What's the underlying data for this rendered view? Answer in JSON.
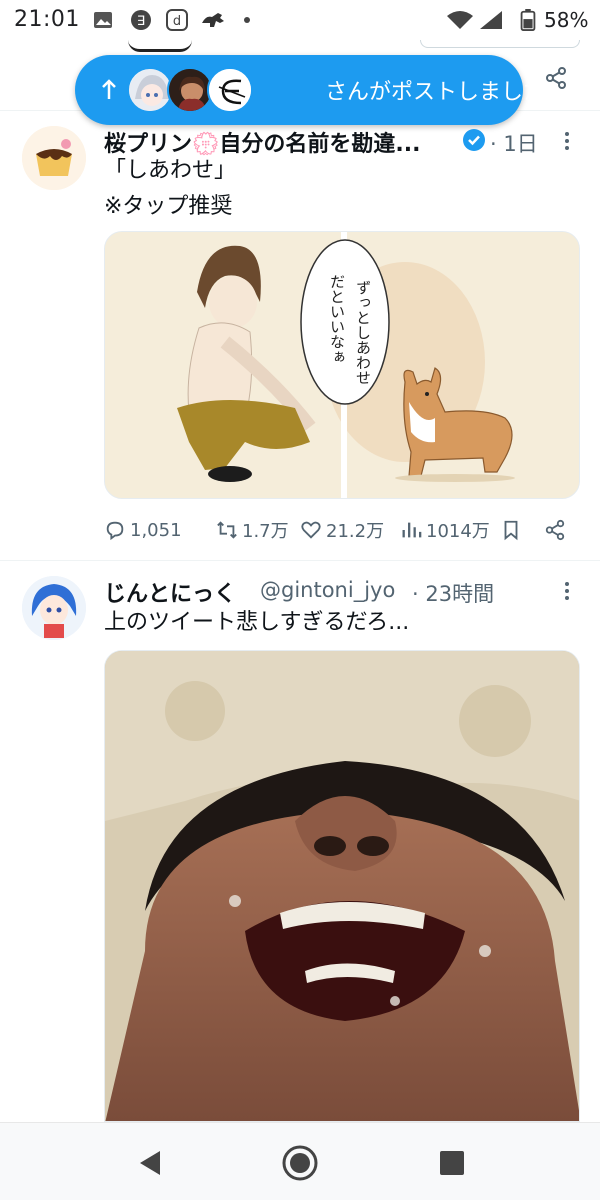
{
  "status_bar": {
    "time": "21:01",
    "battery": "58%",
    "icons": [
      "gallery-icon",
      "e-app-icon",
      "d-app-icon",
      "horse-icon",
      "wifi-icon",
      "signal-icon",
      "battery-icon"
    ]
  },
  "new_posts_pill": {
    "text": "さんがポストしました",
    "icon": "arrow-up-icon"
  },
  "tweets": [
    {
      "name": "桜プリン💮自分の名前を勘違...",
      "verified": true,
      "time": "· 1日",
      "text_lines": [
        "「しあわせ」",
        "※タップ推奨"
      ],
      "comic_bubble": [
        "ずっとしあわせ",
        "だといいなぁ"
      ],
      "stats": {
        "replies": "1,051",
        "reposts": "1.7万",
        "likes": "21.2万",
        "views": "1014万"
      }
    },
    {
      "name": "じんとにっく",
      "handle": "@gintoni_jyo",
      "time": "· 23時間",
      "text_lines": [
        "上のツイート悲しすぎるだろ..."
      ]
    }
  ],
  "colors": {
    "accent": "#1d9bf0",
    "text": "#0f1419",
    "secondary": "#536471",
    "divider": "#eff3f4"
  },
  "nav": {
    "icons": [
      "back-icon",
      "home-icon",
      "recents-icon"
    ]
  }
}
